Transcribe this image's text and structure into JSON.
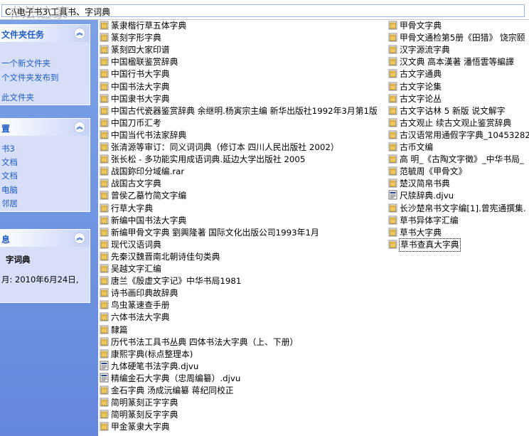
{
  "address": {
    "path": "C:\\电子书3\\工具书、字词典"
  },
  "watermark": {
    "text": "书法之家",
    "sub": "SHUFA.ORG"
  },
  "tasks_panel": {
    "title": "文件夹任务",
    "items": [
      "一个新文件夹",
      "个文件夹发布到",
      "此文件夹"
    ]
  },
  "places_panel": {
    "title": "置",
    "items": [
      "书3",
      "文档",
      "文档",
      "电脑",
      "邻居"
    ]
  },
  "details_panel": {
    "title": "息",
    "name": "字词典",
    "date": "月: 2010年6月24日,"
  },
  "files_col1": [
    {
      "name": "篆隶楷行草五体字典",
      "icon": "folder"
    },
    {
      "name": "篆刻字形字典",
      "icon": "folder"
    },
    {
      "name": "篆刻四大家印谱",
      "icon": "folder"
    },
    {
      "name": "中国楹联鉴赏辞典",
      "icon": "folder"
    },
    {
      "name": "中国行书大字典",
      "icon": "folder"
    },
    {
      "name": "中国书法大字典",
      "icon": "folder"
    },
    {
      "name": "中国隶书大字典",
      "icon": "folder"
    },
    {
      "name": "中国古代瓷器鉴赏辞典 余继明.杨寅宗主编 新华出版社1992年3月第1版",
      "icon": "folder"
    },
    {
      "name": "中国刀币汇考",
      "icon": "folder"
    },
    {
      "name": "中国当代书法家辞典",
      "icon": "folder"
    },
    {
      "name": "张清源等审订：同义词词典（修订本 四川人民出版社 2002）",
      "icon": "folder"
    },
    {
      "name": "张长松 - 多功能实用成语词典.延边大学出版社 2005",
      "icon": "folder"
    },
    {
      "name": "战国鉨印分域编.rar",
      "icon": "folder"
    },
    {
      "name": "战国古文字典",
      "icon": "folder"
    },
    {
      "name": "曾侯乙墓竹简文字编",
      "icon": "folder"
    },
    {
      "name": "行草大字典",
      "icon": "folder"
    },
    {
      "name": "新编中国书法大字典",
      "icon": "folder"
    },
    {
      "name": "新编甲骨文字典 劉興隆著 国际文化出版公司1993年1月",
      "icon": "folder"
    },
    {
      "name": "现代汉语词典",
      "icon": "folder"
    },
    {
      "name": "先秦汉魏晋南北朝诗佳句类典",
      "icon": "folder"
    },
    {
      "name": "吴越文字汇编",
      "icon": "folder"
    },
    {
      "name": "唐兰《殷虚文字记》中华书局1981",
      "icon": "folder"
    },
    {
      "name": "诗书画印典故辞典",
      "icon": "folder"
    },
    {
      "name": "鸟虫篆速查手册",
      "icon": "folder"
    },
    {
      "name": "六体书法大字典",
      "icon": "folder"
    },
    {
      "name": "隸篇",
      "icon": "folder"
    },
    {
      "name": "历代书法工具书丛典 四体书法大字典（上、下册）",
      "icon": "folder"
    },
    {
      "name": "康熙字典(标点整理本)",
      "icon": "folder"
    },
    {
      "name": "九体硬笔书法字典.djvu",
      "icon": "djvu"
    },
    {
      "name": "精编金石大字典（忠周编纂）.djvu",
      "icon": "djvu"
    },
    {
      "name": "金石字典 汤成沅编纂 蒋纪同校正",
      "icon": "folder"
    },
    {
      "name": "简明篆刻正字字典",
      "icon": "folder"
    },
    {
      "name": "简明篆刻反字字典",
      "icon": "folder"
    },
    {
      "name": "甲金篆隶大字典",
      "icon": "folder"
    }
  ],
  "files_col2": [
    {
      "name": "甲骨文字典",
      "icon": "folder"
    },
    {
      "name": "甲骨文通检第5册《田猎》 饶宗颐",
      "icon": "folder"
    },
    {
      "name": "汉字源流字典",
      "icon": "folder"
    },
    {
      "name": "汉文典 高本漢著 潘悟雲等編譯",
      "icon": "folder"
    },
    {
      "name": "古文字通典",
      "icon": "folder"
    },
    {
      "name": "古文字论集",
      "icon": "folder"
    },
    {
      "name": "古文字论丛",
      "icon": "folder"
    },
    {
      "name": "古文字诂林 5 新版 说文解字",
      "icon": "folder"
    },
    {
      "name": "古文观止 续古文观止鉴赏辞典",
      "icon": "folder"
    },
    {
      "name": "古汉语常用通假字字典_10453282",
      "icon": "folder"
    },
    {
      "name": "古币文编",
      "icon": "folder"
    },
    {
      "name": "高 明_《古陶文字徵》_中华书局_",
      "icon": "folder"
    },
    {
      "name": "范毓周《甲骨文》",
      "icon": "folder"
    },
    {
      "name": "楚汉简帛书典",
      "icon": "folder"
    },
    {
      "name": "尺牍辞典.djvu",
      "icon": "djvu"
    },
    {
      "name": "长沙楚帛书文字编[1].曾宪通撰集.",
      "icon": "folder"
    },
    {
      "name": "草书异体字汇编",
      "icon": "folder"
    },
    {
      "name": "草书大字典",
      "icon": "folder"
    },
    {
      "name": "草书查真大字典",
      "icon": "folder",
      "selected": true
    }
  ],
  "colors": {
    "accent": "#215dc6",
    "left_bg": "#7aa1e6",
    "panel_bg": "#d6dff7",
    "folder": "#f0c860"
  }
}
